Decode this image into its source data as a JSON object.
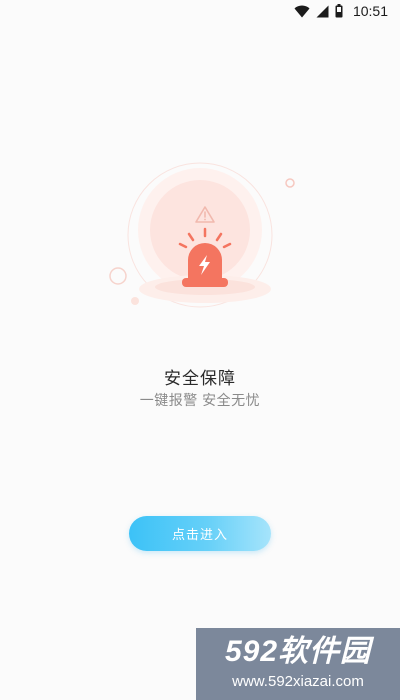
{
  "status_bar": {
    "time": "10:51",
    "icons": [
      "wifi-icon",
      "signal-icon",
      "battery-icon"
    ]
  },
  "hero": {
    "icons": [
      "warning-triangle-icon",
      "alarm-siren-icon",
      "lightning-bolt-icon"
    ],
    "colors": {
      "siren": "#f47560",
      "halo": "#fde1dc",
      "base": "#fdeeea"
    }
  },
  "main": {
    "title": "安全保障",
    "subtitle": "一键报警 安全无忧",
    "enter_button_label": "点击进入"
  },
  "watermark": {
    "brand": "592软件园",
    "url": "www.592xiazai.com"
  },
  "colors": {
    "button_gradient_start": "#3cc2f7",
    "button_gradient_end": "#a6e4fb",
    "background": "#fbfbfb"
  }
}
